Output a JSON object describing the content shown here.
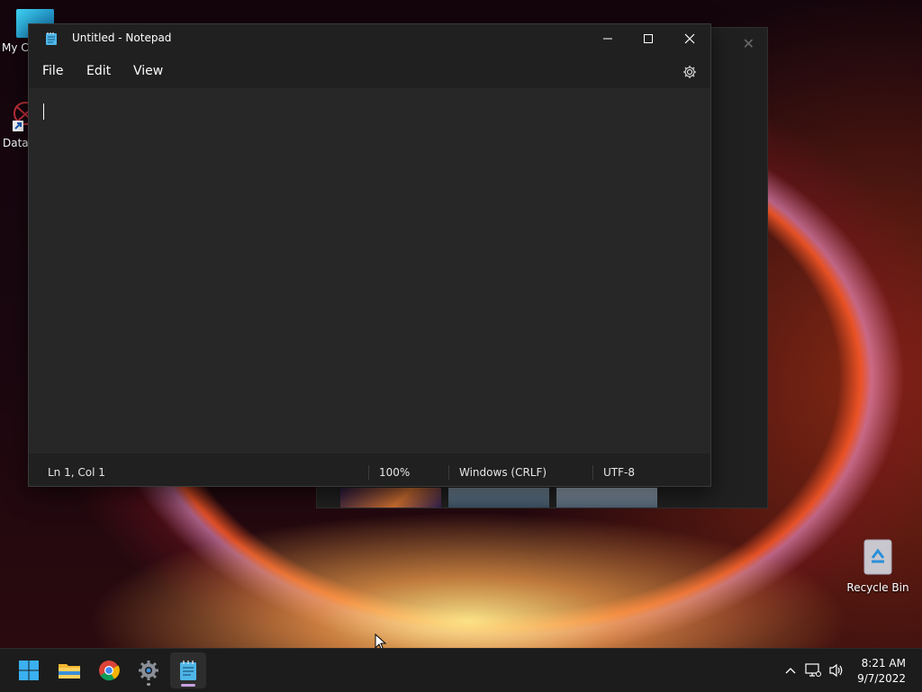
{
  "desktop": {
    "icons": [
      {
        "label": "My Co"
      },
      {
        "label": "DataW"
      },
      {
        "label": "Recycle Bin"
      }
    ]
  },
  "notepad": {
    "title": "Untitled - Notepad",
    "menu": [
      "File",
      "Edit",
      "View"
    ],
    "status": {
      "position": "Ln 1, Col 1",
      "zoom": "100%",
      "line_endings": "Windows (CRLF)",
      "encoding": "UTF-8"
    }
  },
  "taskbar": {
    "apps": [
      "start-icon",
      "file-explorer-icon",
      "chrome-icon",
      "settings-icon",
      "notepad-icon"
    ],
    "clock": {
      "time": "8:21 AM",
      "date": "9/7/2022"
    }
  },
  "colors": {
    "accent": "#c8a0e0",
    "window_bg": "#202020",
    "editor_bg": "#272727",
    "taskbar_bg": "#1c1c1c"
  }
}
